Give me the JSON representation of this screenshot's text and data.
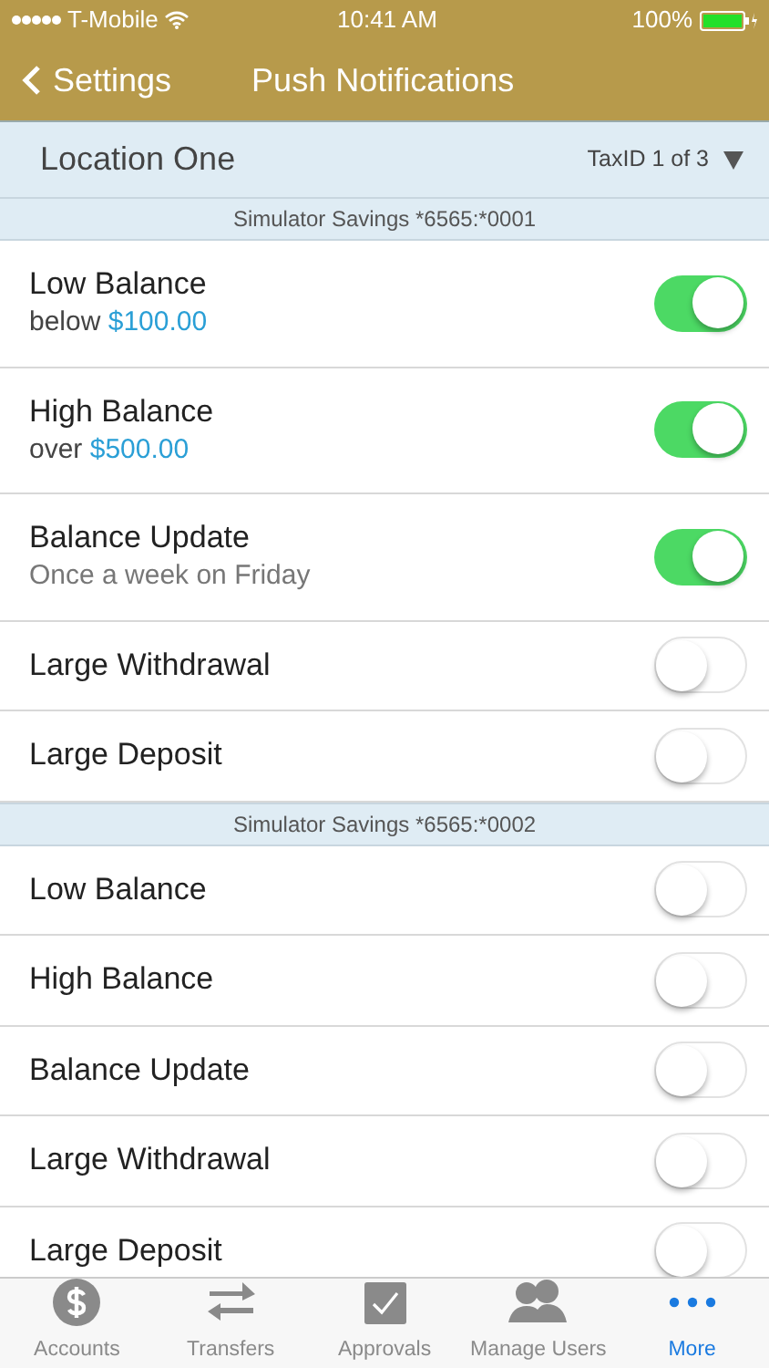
{
  "status_bar": {
    "carrier": "T-Mobile",
    "time": "10:41 AM",
    "battery": "100%"
  },
  "nav": {
    "back": "Settings",
    "title": "Push Notifications"
  },
  "location": {
    "name": "Location One",
    "selector": "TaxID 1 of 3"
  },
  "sections": [
    {
      "header": "Simulator Savings *6565:*0001",
      "rows": [
        {
          "label": "Low Balance",
          "detail": "below",
          "amount": "$100.00",
          "on": true
        },
        {
          "label": "High Balance",
          "detail": "over",
          "amount": "$500.00",
          "on": true
        },
        {
          "label": "Balance Update",
          "detail": "Once a week on Friday",
          "on": true
        },
        {
          "label": "Large Withdrawal",
          "on": false
        },
        {
          "label": "Large Deposit",
          "on": false
        }
      ]
    },
    {
      "header": "Simulator Savings *6565:*0002",
      "rows": [
        {
          "label": "Low Balance",
          "on": false
        },
        {
          "label": "High Balance",
          "on": false
        },
        {
          "label": "Balance Update",
          "on": false
        },
        {
          "label": "Large Withdrawal",
          "on": false
        },
        {
          "label": "Large Deposit",
          "on": false
        }
      ]
    }
  ],
  "tab_bar": [
    {
      "kind": "dollar",
      "label": "Accounts",
      "selected": false
    },
    {
      "kind": "arrows",
      "label": "Transfers",
      "selected": false
    },
    {
      "kind": "check",
      "label": "Approvals",
      "selected": false
    },
    {
      "kind": "users",
      "label": "Manage Users",
      "selected": false
    },
    {
      "kind": "more",
      "label": "More",
      "selected": true
    }
  ]
}
